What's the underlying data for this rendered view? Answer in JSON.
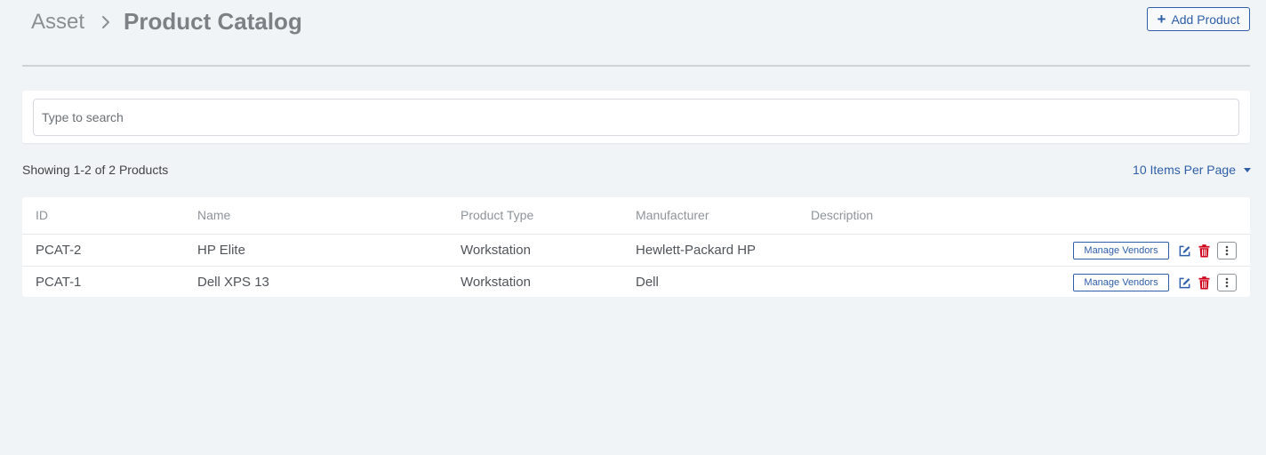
{
  "breadcrumb": {
    "root": "Asset",
    "current": "Product Catalog"
  },
  "header": {
    "add_button_label": "Add Product"
  },
  "search": {
    "placeholder": "Type to search",
    "value": ""
  },
  "summary": {
    "showing_text": "Showing 1-2 of 2 Products",
    "per_page_label": "10 Items Per Page"
  },
  "table": {
    "columns": [
      "ID",
      "Name",
      "Product Type",
      "Manufacturer",
      "Description"
    ],
    "rows": [
      {
        "id": "PCAT-2",
        "name": "HP Elite",
        "product_type": "Workstation",
        "manufacturer": "Hewlett-Packard HP",
        "description": "",
        "manage_vendors_label": "Manage Vendors"
      },
      {
        "id": "PCAT-1",
        "name": "Dell XPS 13",
        "product_type": "Workstation",
        "manufacturer": "Dell",
        "description": "",
        "manage_vendors_label": "Manage Vendors"
      }
    ]
  },
  "icons": {
    "breadcrumb_separator": "chevron-right-icon",
    "add": "plus-icon",
    "per_page": "caret-down-icon",
    "edit": "edit-icon",
    "delete": "trash-icon",
    "more": "more-vertical-icon"
  },
  "colors": {
    "background": "#f0f4f7",
    "accent": "#2f5ea8",
    "danger": "#d0021b",
    "card": "#ffffff",
    "muted_text": "#8f9499"
  }
}
